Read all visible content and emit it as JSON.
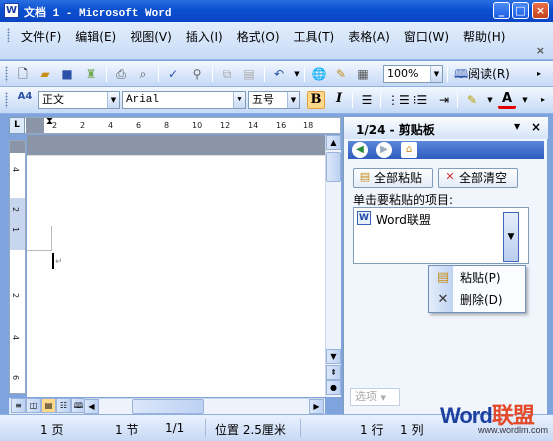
{
  "window": {
    "title": "文档 1 - Microsoft Word",
    "app_icon": "W",
    "minimize_icon": "_",
    "maximize_icon": "□",
    "close_icon": "×"
  },
  "menubar": {
    "items": [
      "文件(F)",
      "编辑(E)",
      "视图(V)",
      "插入(I)",
      "格式(O)",
      "工具(T)",
      "表格(A)",
      "窗口(W)",
      "帮助(H)"
    ],
    "close_doc": "×"
  },
  "toolbar1": {
    "zoom": "100%",
    "read_label": "阅读(R)"
  },
  "toolbar2": {
    "style_icon": "A4",
    "style": "正文",
    "font": "Arial",
    "size": "五号",
    "bold": "B",
    "italic": "I",
    "font_color_icon": "A"
  },
  "ruler": {
    "corner": "L",
    "ticks": [
      "2",
      "2",
      "4",
      "6",
      "8",
      "10",
      "12",
      "14",
      "16",
      "18"
    ],
    "vticks": [
      "4",
      "2",
      "1",
      "2",
      "4",
      "6"
    ]
  },
  "taskpane": {
    "title": "1/24 - 剪贴板",
    "close": "×",
    "paste_all": "全部粘贴",
    "clear_all": "全部清空",
    "label": "单击要粘贴的项目:",
    "clip_item": "Word联盟",
    "options": "选项",
    "context_menu": [
      {
        "label": "粘贴(P)",
        "icon": "paste-icon"
      },
      {
        "label": "删除(D)",
        "icon": "delete-icon"
      }
    ]
  },
  "status": {
    "page": "1 页",
    "section": "1 节",
    "pages": "1/1",
    "position": "位置 2.5厘米",
    "line": "1 行",
    "col": "1 列"
  },
  "watermark": {
    "word_a": "Word",
    "word_b": "联盟",
    "url": "www.wordlm.com"
  }
}
